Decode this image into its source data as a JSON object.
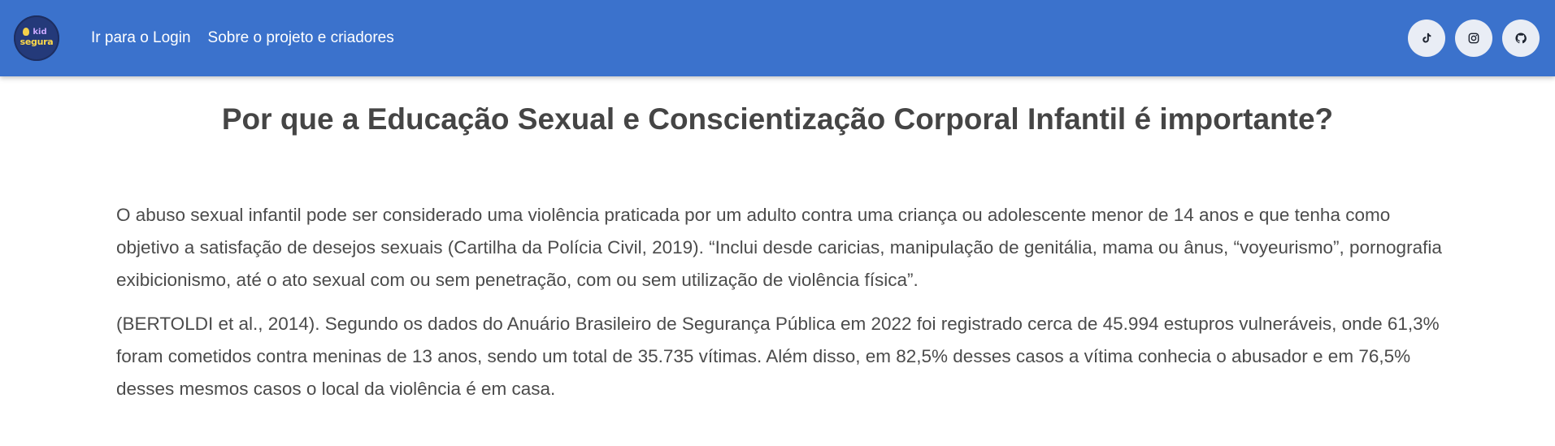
{
  "nav": {
    "logo": {
      "top_text": "kid",
      "bottom_text": "segura",
      "icon": "lightbulb-icon"
    },
    "links": [
      "Ir para o Login",
      "Sobre o projeto e criadores"
    ],
    "social": [
      {
        "icon": "tiktok-icon"
      },
      {
        "icon": "instagram-icon"
      },
      {
        "icon": "github-icon"
      }
    ]
  },
  "colors": {
    "navbar": "#3b72cc",
    "social_button_bg": "#e9edf5",
    "text": "#4b4b4b"
  },
  "main": {
    "title": "Por que a Educação Sexual e Conscientização Corporal Infantil é importante?",
    "paragraphs": [
      "O abuso sexual infantil pode ser considerado uma violência praticada por um adulto contra uma criança ou adolescente menor de 14 anos e que tenha como objetivo a satisfação de desejos sexuais (Cartilha da Polícia Civil, 2019). “Inclui desde caricias, manipulação de genitália, mama ou ânus, “voyeurismo”, pornografia exibicionismo, até o ato sexual com ou sem penetração, com ou sem utilização de violência física”.",
      "(BERTOLDI et al., 2014). Segundo os dados do Anuário Brasileiro de Segurança Pública em 2022 foi registrado cerca de 45.994 estupros vulneráveis, onde 61,3% foram cometidos contra meninas de 13 anos, sendo um total de 35.735 vítimas. Além disso, em 82,5% desses casos a vítima conhecia o abusador e em 76,5% desses mesmos casos o local da violência é em casa."
    ]
  }
}
